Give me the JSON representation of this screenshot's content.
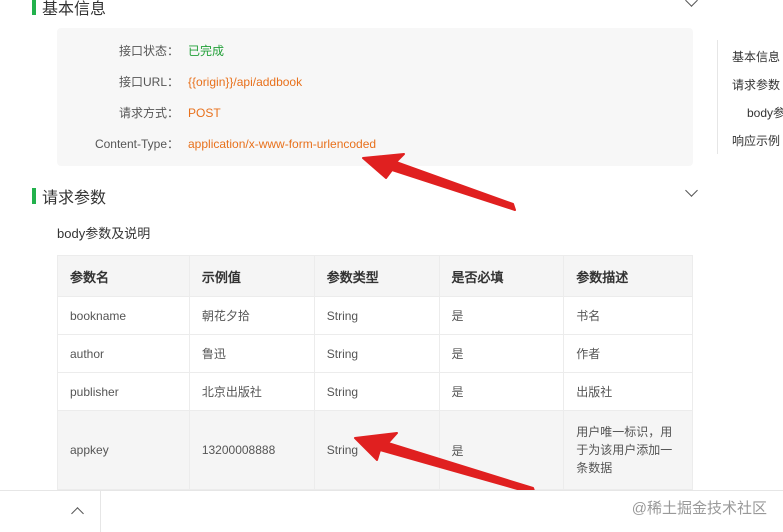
{
  "basic_info": {
    "title": "基本信息",
    "rows": [
      {
        "label": "接口状态：",
        "value": "已完成"
      },
      {
        "label": "接口URL：",
        "value": "{{origin}}/api/addbook"
      },
      {
        "label": "请求方式：",
        "value": "POST"
      },
      {
        "label": "Content-Type：",
        "value": "application/x-www-form-urlencoded"
      }
    ]
  },
  "request_params": {
    "title": "请求参数",
    "subtitle": "body参数及说明",
    "columns": [
      "参数名",
      "示例值",
      "参数类型",
      "是否必填",
      "参数描述"
    ],
    "rows": [
      [
        "bookname",
        "朝花夕拾",
        "String",
        "是",
        "书名"
      ],
      [
        "author",
        "鲁迅",
        "String",
        "是",
        "作者"
      ],
      [
        "publisher",
        "北京出版社",
        "String",
        "是",
        "出版社"
      ],
      [
        "appkey",
        "13200008888",
        "String",
        "是",
        "用户唯一标识，用于为该用户添加一条数据"
      ]
    ],
    "appkey_desc_lines": [
      "用户唯一标识，用",
      "于为该用户添加一",
      "条数据"
    ]
  },
  "toc": {
    "items": [
      "基本信息",
      "请求参数",
      "body参",
      "响应示例"
    ]
  },
  "watermark": "@稀土掘金技术社区",
  "colors": {
    "accent": "#22b14c",
    "status_green": "#22a038",
    "value_orange": "#e8711c",
    "arrow_red": "#e02020"
  }
}
